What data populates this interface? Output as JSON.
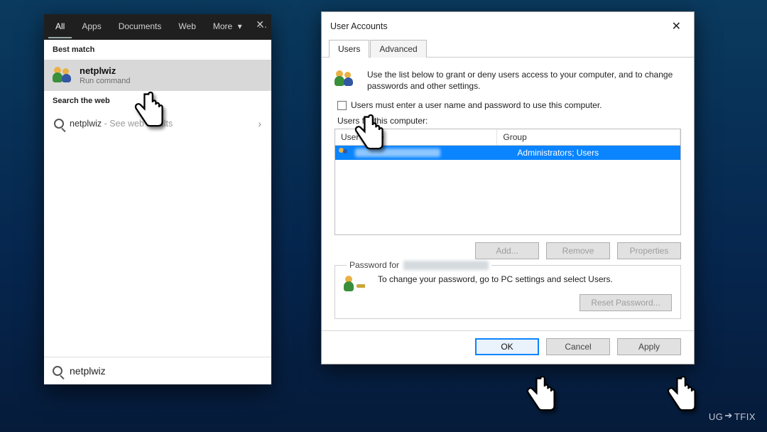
{
  "search": {
    "tabs": {
      "all": "All",
      "apps": "Apps",
      "documents": "Documents",
      "web": "Web",
      "more": "More"
    },
    "best_match_header": "Best match",
    "result": {
      "title": "netplwiz",
      "subtitle": "Run command"
    },
    "web_section_header": "Search the web",
    "web_result_prefix": "netplwiz",
    "web_result_suffix": " - See web results",
    "chevron": "›",
    "input_value": "netplwiz"
  },
  "dialog": {
    "title": "User Accounts",
    "tabs": {
      "users": "Users",
      "advanced": "Advanced"
    },
    "intro": "Use the list below to grant or deny users access to your computer, and to change passwords and other settings.",
    "checkbox_label": "Users must enter a user name and password to use this computer.",
    "list_label_prefix": "Users for this computer:",
    "columns": {
      "user": "User Name",
      "group": "Group"
    },
    "row": {
      "group": "Administrators; Users"
    },
    "buttons": {
      "add": "Add...",
      "remove": "Remove",
      "props": "Properties",
      "reset": "Reset Password...",
      "ok": "OK",
      "cancel": "Cancel",
      "apply": "Apply"
    },
    "password_legend": "Password for",
    "password_text": "To change your password, go to PC settings and select Users."
  },
  "watermark": {
    "pre": "UG",
    "mid": "➔",
    "post": "TFIX"
  }
}
